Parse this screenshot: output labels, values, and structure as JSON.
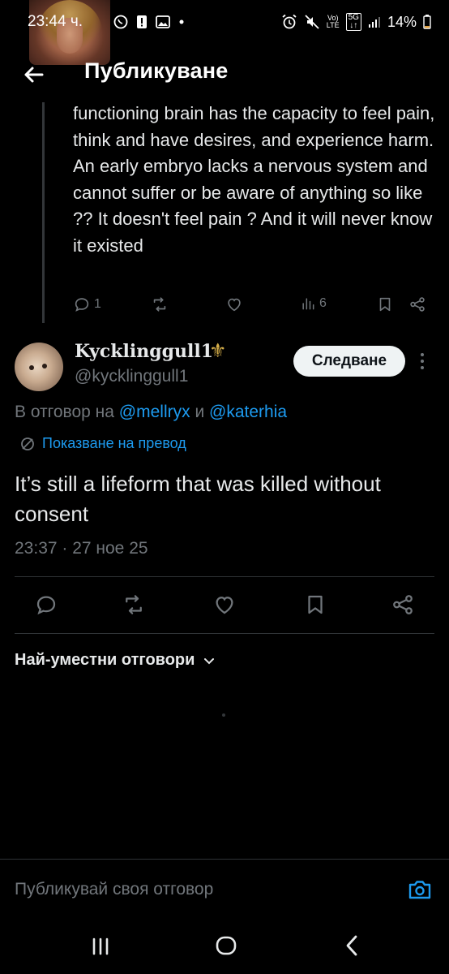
{
  "status_bar": {
    "time": "23:44 ч.",
    "network": "5G",
    "volte": "Vo) LTE",
    "battery": "14%"
  },
  "header": {
    "title": "Публикуване"
  },
  "previous_post": {
    "text": "functioning brain has the capacity to feel pain, think and have desires, and experience harm. An early embryo lacks a nervous system and cannot suffer or be aware of anything so like ?? It doesn't feel pain ? And it will never know it existed",
    "reply_count": "1",
    "views": "6"
  },
  "post": {
    "display_name": "Kycklinggull1",
    "name_emoji": "⚜",
    "handle": "@kycklinggull1",
    "follow_label": "Следване",
    "reply_to_prefix": "В отговор на",
    "reply_to_user1": "@mellryx",
    "reply_to_and": "и",
    "reply_to_user2": "@katerhia",
    "translate_label": "Показване на превод",
    "text": "It’s still a lifeform that was killed without consent",
    "timestamp": "23:37 · 27 ное 25"
  },
  "replies": {
    "sort_label": "Най-уместни отговори"
  },
  "composer": {
    "placeholder": "Публикувай своя отговор"
  },
  "colors": {
    "background": "#000000",
    "text": "#e7e9ea",
    "muted": "#71767b",
    "accent": "#1d9bf0",
    "divider": "#2f3336"
  }
}
